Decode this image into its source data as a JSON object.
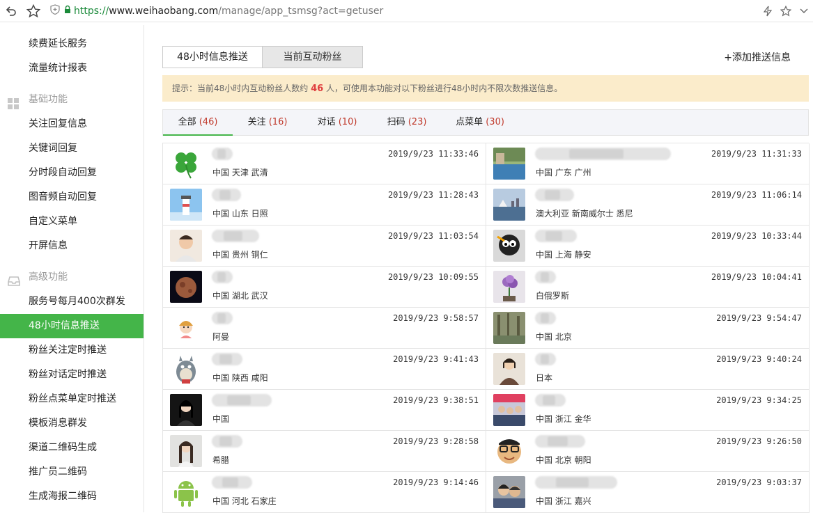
{
  "browser": {
    "url_scheme": "https://",
    "url_host": "www.weihaobang.com",
    "url_path": "/manage/app_tsmsg?act=getuser",
    "icons": [
      "back-icon",
      "star-icon",
      "shield-icon",
      "lock-icon",
      "lightning-icon",
      "star-icon",
      "chevron-down-icon"
    ]
  },
  "sidebar": {
    "items": [
      {
        "label": "续费延长服务",
        "type": "item"
      },
      {
        "label": "流量统计报表",
        "type": "item"
      },
      {
        "label": "基础功能",
        "type": "head",
        "icon": "grid-icon"
      },
      {
        "label": "关注回复信息",
        "type": "item"
      },
      {
        "label": "关键词回复",
        "type": "item"
      },
      {
        "label": "分时段自动回复",
        "type": "item"
      },
      {
        "label": "图音频自动回复",
        "type": "item"
      },
      {
        "label": "自定义菜单",
        "type": "item"
      },
      {
        "label": "开屏信息",
        "type": "item"
      },
      {
        "label": "高级功能",
        "type": "head",
        "icon": "inbox-icon"
      },
      {
        "label": "服务号每月400次群发",
        "type": "item"
      },
      {
        "label": "48小时信息推送",
        "type": "item",
        "active": true
      },
      {
        "label": "粉丝关注定时推送",
        "type": "item"
      },
      {
        "label": "粉丝对话定时推送",
        "type": "item"
      },
      {
        "label": "粉丝点菜单定时推送",
        "type": "item"
      },
      {
        "label": "模板消息群发",
        "type": "item"
      },
      {
        "label": "渠道二维码生成",
        "type": "item"
      },
      {
        "label": "推广员二维码",
        "type": "item"
      },
      {
        "label": "生成海报二维码",
        "type": "item"
      }
    ],
    "active_color": "#44b549"
  },
  "tabs": {
    "push": "48小时信息推送",
    "fans": "当前互动粉丝",
    "add_link": "+添加推送信息"
  },
  "tip": {
    "prefix": "提示：当前48小时内互动粉丝人数约",
    "count": "46",
    "suffix": "人，可使用本功能对以下粉丝进行48小时内不限次数推送信息。"
  },
  "filters": [
    {
      "label": "全部",
      "count": "(46)",
      "active": true
    },
    {
      "label": "关注",
      "count": "(16)"
    },
    {
      "label": "对话",
      "count": "(10)"
    },
    {
      "label": "扫码",
      "count": "(23)"
    },
    {
      "label": "点菜单",
      "count": "(30)"
    }
  ],
  "fans": [
    {
      "time": "2019/9/23 11:33:46",
      "location": "中国 天津 武清",
      "avatar": "clover-avatar",
      "nick_width": 30
    },
    {
      "time": "2019/9/23 11:31:33",
      "location": "中国 广东 广州",
      "avatar": "pool-avatar",
      "nick_width": 195
    },
    {
      "time": "2019/9/23 11:28:43",
      "location": "中国 山东 日照",
      "avatar": "lighthouse-avatar",
      "nick_width": 42
    },
    {
      "time": "2019/9/23 11:06:14",
      "location": "澳大利亚 新南威尔士 悉尼",
      "avatar": "city-avatar",
      "nick_width": 56
    },
    {
      "time": "2019/9/23 11:03:54",
      "location": "中国 贵州 铜仁",
      "avatar": "man-avatar",
      "nick_width": 68
    },
    {
      "time": "2019/9/23 10:33:44",
      "location": "中国 上海 静安",
      "avatar": "cartoon-avatar",
      "nick_width": 60
    },
    {
      "time": "2019/9/23 10:09:55",
      "location": "中国 湖北 武汉",
      "avatar": "planet-avatar",
      "nick_width": 30
    },
    {
      "time": "2019/9/23 10:04:41",
      "location": "白俄罗斯",
      "avatar": "flower-avatar",
      "nick_width": 30
    },
    {
      "time": "2019/9/23 9:58:57",
      "location": "阿曼",
      "avatar": "girl-cartoon-avatar",
      "nick_width": 30
    },
    {
      "time": "2019/9/23 9:54:47",
      "location": "中国 北京",
      "avatar": "forest-avatar",
      "nick_width": 30
    },
    {
      "time": "2019/9/23 9:41:43",
      "location": "中国 陕西 咸阳",
      "avatar": "totoro-avatar",
      "nick_width": 44
    },
    {
      "time": "2019/9/23 9:40:24",
      "location": "日本",
      "avatar": "woman-avatar",
      "nick_width": 30
    },
    {
      "time": "2019/9/23 9:38:51",
      "location": "中国",
      "avatar": "portrait-avatar",
      "nick_width": 86
    },
    {
      "time": "2019/9/23 9:34:25",
      "location": "中国 浙江 金华",
      "avatar": "group-avatar",
      "nick_width": 44
    },
    {
      "time": "2019/9/23 9:28:58",
      "location": "希腊",
      "avatar": "longhair-avatar",
      "nick_width": 44
    },
    {
      "time": "2019/9/23 9:26:50",
      "location": "中国 北京 朝阳",
      "avatar": "glasses-avatar",
      "nick_width": 72
    },
    {
      "time": "2019/9/23 9:14:46",
      "location": "中国 河北 石家庄",
      "avatar": "android-avatar",
      "nick_width": 58
    },
    {
      "time": "2019/9/23 9:03:37",
      "location": "中国 浙江 嘉兴",
      "avatar": "couple-avatar",
      "nick_width": 118
    }
  ]
}
